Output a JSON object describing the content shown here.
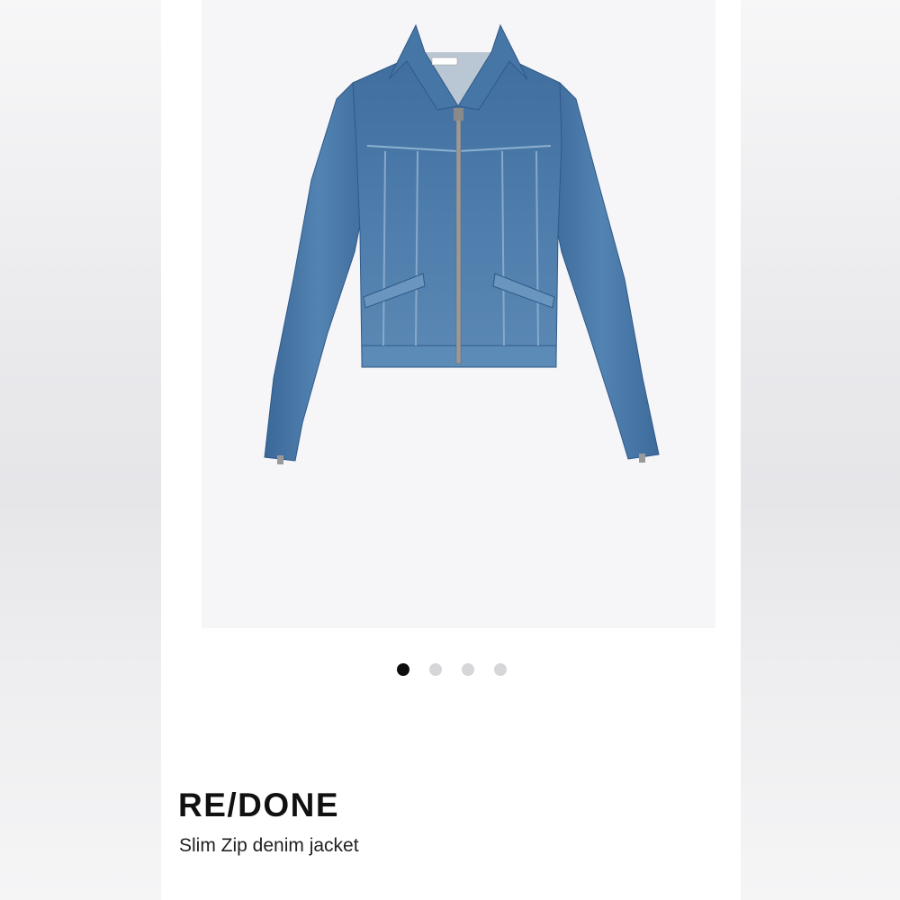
{
  "product": {
    "brand": "RE/DONE",
    "name": "Slim Zip denim jacket",
    "label_text": "RE/DONE",
    "image_alt": "denim-jacket-image"
  },
  "carousel": {
    "total": 4,
    "active_index": 0
  },
  "colors": {
    "denim": "#4a78a8",
    "denim_dark": "#36608f",
    "dot_active": "#0d0d0d",
    "dot_inactive": "#d6d6d8"
  }
}
